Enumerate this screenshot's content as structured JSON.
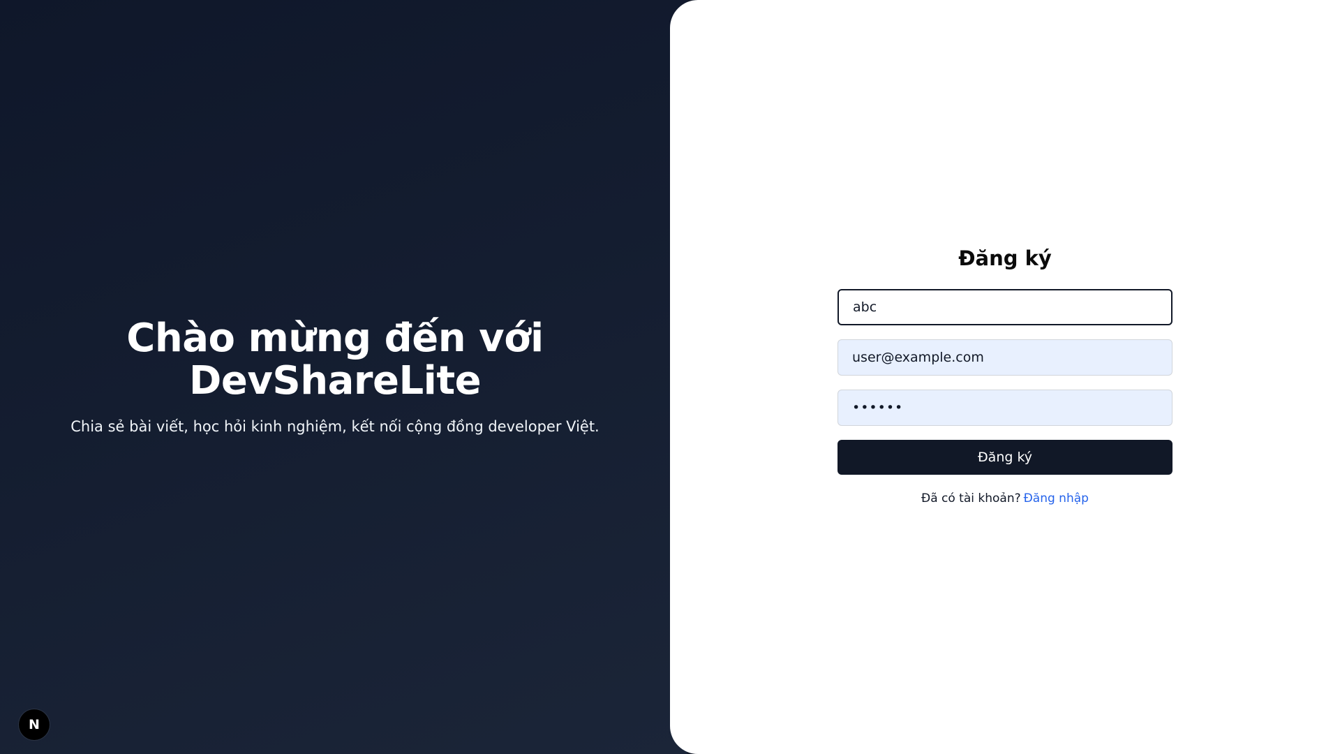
{
  "hero": {
    "title": "Chào mừng đến với DevShareLite",
    "subtitle": "Chia sẻ bài viết, học hỏi kinh nghiệm, kết nối cộng đồng developer Việt."
  },
  "badge": {
    "letter": "N",
    "icon": "nextjs-logo-icon"
  },
  "form": {
    "title": "Đăng ký",
    "name_value": "abc",
    "email_value": "user@example.com",
    "password_value": "••••••",
    "submit_label": "Đăng ký",
    "switch_prompt": "Đã có tài khoản?",
    "switch_link": "Đăng nhập"
  },
  "colors": {
    "hero_bg": "#0f172a",
    "button_bg": "#111827",
    "autofill_bg": "#e8f0fe",
    "link": "#2563eb"
  }
}
